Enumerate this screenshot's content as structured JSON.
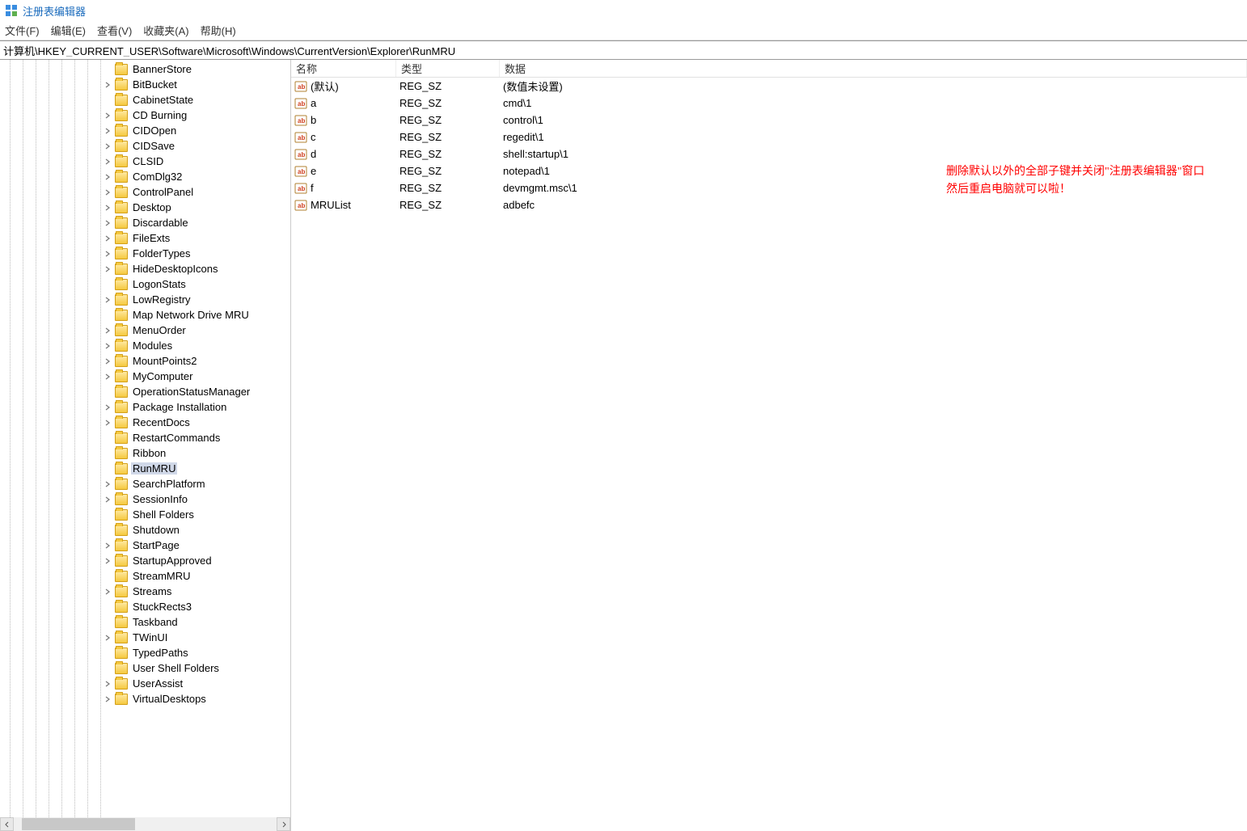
{
  "window": {
    "title": "注册表编辑器"
  },
  "menu": {
    "file": "文件(F)",
    "edit": "编辑(E)",
    "view": "查看(V)",
    "favorites": "收藏夹(A)",
    "help": "帮助(H)"
  },
  "address": "计算机\\HKEY_CURRENT_USER\\Software\\Microsoft\\Windows\\CurrentVersion\\Explorer\\RunMRU",
  "tree": [
    {
      "label": "BannerStore",
      "expandable": false
    },
    {
      "label": "BitBucket",
      "expandable": true
    },
    {
      "label": "CabinetState",
      "expandable": false
    },
    {
      "label": "CD Burning",
      "expandable": true
    },
    {
      "label": "CIDOpen",
      "expandable": true
    },
    {
      "label": "CIDSave",
      "expandable": true
    },
    {
      "label": "CLSID",
      "expandable": true
    },
    {
      "label": "ComDlg32",
      "expandable": true
    },
    {
      "label": "ControlPanel",
      "expandable": true
    },
    {
      "label": "Desktop",
      "expandable": true
    },
    {
      "label": "Discardable",
      "expandable": true
    },
    {
      "label": "FileExts",
      "expandable": true
    },
    {
      "label": "FolderTypes",
      "expandable": true
    },
    {
      "label": "HideDesktopIcons",
      "expandable": true
    },
    {
      "label": "LogonStats",
      "expandable": false
    },
    {
      "label": "LowRegistry",
      "expandable": true
    },
    {
      "label": "Map Network Drive MRU",
      "expandable": false
    },
    {
      "label": "MenuOrder",
      "expandable": true
    },
    {
      "label": "Modules",
      "expandable": true
    },
    {
      "label": "MountPoints2",
      "expandable": true
    },
    {
      "label": "MyComputer",
      "expandable": true
    },
    {
      "label": "OperationStatusManager",
      "expandable": false
    },
    {
      "label": "Package Installation",
      "expandable": true
    },
    {
      "label": "RecentDocs",
      "expandable": true
    },
    {
      "label": "RestartCommands",
      "expandable": false
    },
    {
      "label": "Ribbon",
      "expandable": false
    },
    {
      "label": "RunMRU",
      "expandable": false,
      "selected": true
    },
    {
      "label": "SearchPlatform",
      "expandable": true
    },
    {
      "label": "SessionInfo",
      "expandable": true
    },
    {
      "label": "Shell Folders",
      "expandable": false
    },
    {
      "label": "Shutdown",
      "expandable": false
    },
    {
      "label": "StartPage",
      "expandable": true
    },
    {
      "label": "StartupApproved",
      "expandable": true
    },
    {
      "label": "StreamMRU",
      "expandable": false
    },
    {
      "label": "Streams",
      "expandable": true
    },
    {
      "label": "StuckRects3",
      "expandable": false
    },
    {
      "label": "Taskband",
      "expandable": false
    },
    {
      "label": "TWinUI",
      "expandable": true
    },
    {
      "label": "TypedPaths",
      "expandable": false
    },
    {
      "label": "User Shell Folders",
      "expandable": false
    },
    {
      "label": "UserAssist",
      "expandable": true
    },
    {
      "label": "VirtualDesktops",
      "expandable": true
    }
  ],
  "columns": {
    "name": "名称",
    "type": "类型",
    "data": "数据"
  },
  "values": [
    {
      "name": "(默认)",
      "type": "REG_SZ",
      "data": "(数值未设置)"
    },
    {
      "name": "a",
      "type": "REG_SZ",
      "data": "cmd\\1"
    },
    {
      "name": "b",
      "type": "REG_SZ",
      "data": "control\\1"
    },
    {
      "name": "c",
      "type": "REG_SZ",
      "data": "regedit\\1"
    },
    {
      "name": "d",
      "type": "REG_SZ",
      "data": "shell:startup\\1"
    },
    {
      "name": "e",
      "type": "REG_SZ",
      "data": "notepad\\1"
    },
    {
      "name": "f",
      "type": "REG_SZ",
      "data": "devmgmt.msc\\1"
    },
    {
      "name": "MRUList",
      "type": "REG_SZ",
      "data": "adbefc"
    }
  ],
  "annotation": {
    "line1": "删除默认以外的全部子键并关闭\"注册表编辑器\"窗口",
    "line2": "然后重启电脑就可以啦！"
  }
}
